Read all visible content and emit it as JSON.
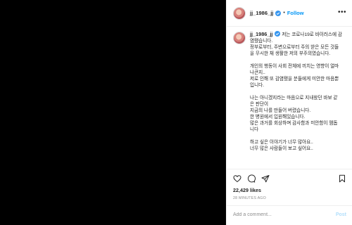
{
  "post": {
    "username": "jj_1986_jj",
    "follow_separator": "•",
    "follow_label": "Follow",
    "more_label": "•••",
    "caption_lines": [
      "저는 코로나19로 바이러스에 감",
      "염됐습니다.",
      "정부로부터, 주변으로부터 주의 받은 모든 것들",
      "을 무시한 채 생활한 저의 부주의였습니다.",
      "",
      "개인의 행동이 사회 전체에 끼치는 영향이 얼마",
      "나큰지..",
      "저로 인해 또 감염됐을 분들에게 미안한 마음뿐",
      "입니다.",
      "",
      "나는 아니겠지라는 마음으로 지내왔던 바보 같",
      "은 판단이",
      "지금의 나를 만들어 버렸습니다.",
      "한 병원에서 입원해있습니다.",
      "많은 과거를 회상하며 감사함과 미안함이 맴돕",
      "니다",
      "",
      "하고 싶은 이야기가 너무 많아요..",
      "너무 많은 사람들이 보고 싶어요.."
    ],
    "likes": "22,429 likes",
    "time_ago": "28 MINUTES AGO",
    "comment_placeholder": "Add a comment...",
    "post_label": "Post"
  },
  "icons": {
    "like": "heart-icon",
    "comment": "comment-icon",
    "share": "paper-plane-icon",
    "save": "bookmark-icon",
    "verified": "verified-badge-icon"
  },
  "colors": {
    "accent": "#0095f6",
    "verified": "#3897f0",
    "media_background": "#000000",
    "post_disabled": "#b2dffc"
  }
}
